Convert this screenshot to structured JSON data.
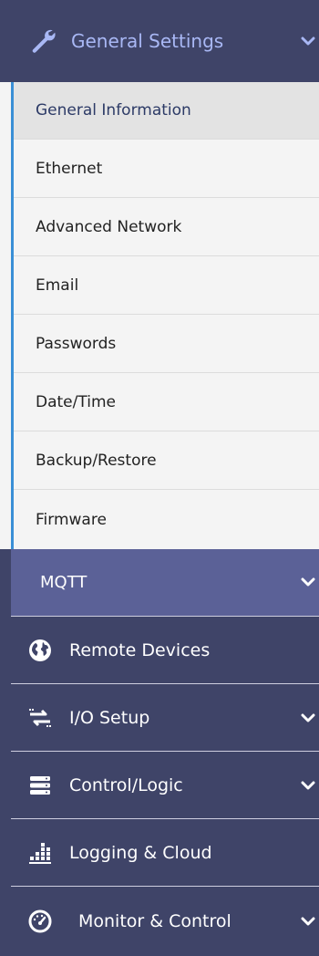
{
  "general_settings": {
    "label": "General Settings",
    "icon": "wrench-icon",
    "expanded": true,
    "items": [
      {
        "label": "General Information",
        "active": true
      },
      {
        "label": "Ethernet"
      },
      {
        "label": "Advanced Network"
      },
      {
        "label": "Email"
      },
      {
        "label": "Passwords"
      },
      {
        "label": "Date/Time"
      },
      {
        "label": "Backup/Restore"
      },
      {
        "label": "Firmware"
      }
    ]
  },
  "mqtt": {
    "label": "MQTT"
  },
  "nav": [
    {
      "label": "Remote Devices",
      "icon": "globe-icon",
      "has_chevron": false
    },
    {
      "label": "I/O Setup",
      "icon": "exchange-arrows-icon",
      "has_chevron": true
    },
    {
      "label": "Control/Logic",
      "icon": "server-stack-icon",
      "has_chevron": true
    },
    {
      "label": "Logging & Cloud",
      "icon": "bar-chart-icon",
      "has_chevron": false
    },
    {
      "label": "Monitor & Control",
      "icon": "gauge-icon",
      "has_chevron": true
    }
  ],
  "colors": {
    "nav_bg": "#3f4468",
    "mqtt_bg": "#5b6197",
    "accent": "#3a8fd6",
    "header_text": "#a9b8f5",
    "submenu_bg": "#f4f4f4"
  }
}
